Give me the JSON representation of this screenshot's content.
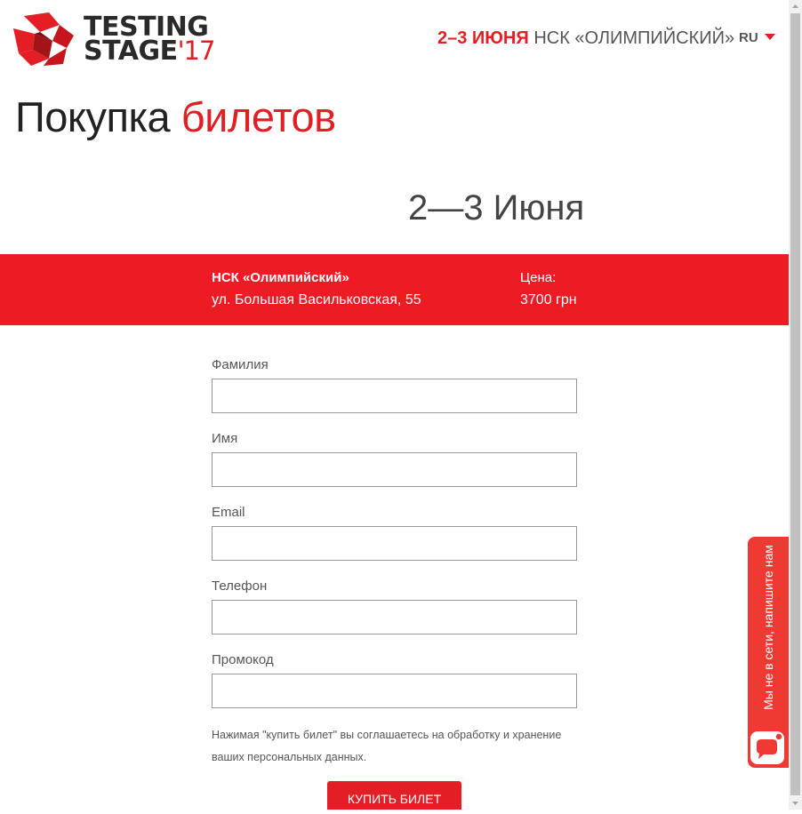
{
  "header": {
    "logo": {
      "line1": "TESTING",
      "line2": "STAGE",
      "year": "'17"
    },
    "event_dates": "2–3 ИЮНЯ",
    "event_venue": "НСК «ОЛИМПИЙСКИЙ»",
    "language": "RU"
  },
  "page_title": {
    "part1": "Покупка",
    "part2": "билетов"
  },
  "date_heading": "2—3 Июня",
  "venue": {
    "name": "НСК «Олимпийский»",
    "address": "ул. Большая Васильковская, 55",
    "price_label": "Цена:",
    "price_value": "3700 грн"
  },
  "form": {
    "fields": [
      {
        "label": "Фамилия",
        "value": ""
      },
      {
        "label": "Имя",
        "value": ""
      },
      {
        "label": "Email",
        "value": ""
      },
      {
        "label": "Телефон",
        "value": ""
      },
      {
        "label": "Промокод",
        "value": ""
      }
    ],
    "consent_line1": "Нажимая \"купить билет\" вы соглашаетесь на обработку и хранение",
    "consent_line2": "ваших персональных данных.",
    "submit_label": "КУПИТЬ БИЛЕТ"
  },
  "chat": {
    "label": "Мы не в сети, напишите нам",
    "icon": "chat-bubble-icon"
  },
  "colors": {
    "accent": "#e31e24",
    "bar": "#ed1c24",
    "chat": "#ee3a32"
  }
}
